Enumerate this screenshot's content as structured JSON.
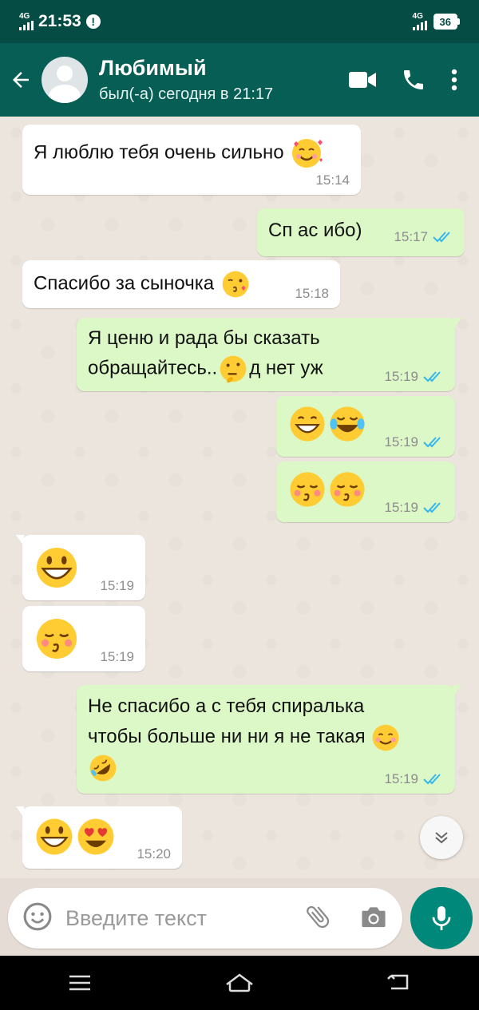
{
  "status_bar": {
    "time": "21:53",
    "network_left": "4G",
    "network_right": "4G",
    "battery": "36"
  },
  "header": {
    "contact_name": "Любимый",
    "last_seen": "был(-а) сегодня в 21:17"
  },
  "colors": {
    "header": "#075e54",
    "outgoing_bubble": "#dcf8c6",
    "incoming_bubble": "#ffffff",
    "read_ticks": "#34b7f1",
    "mic_button": "#00897b"
  },
  "messages": [
    {
      "dir": "in",
      "text": "Я люблю тебя очень сильно",
      "emoji": [
        "smiling-face-with-hearts"
      ],
      "time": "15:14"
    },
    {
      "dir": "out",
      "text": "Сп ас ибо)",
      "time": "15:17",
      "status": "read"
    },
    {
      "dir": "in",
      "text": "Спасибо за сыночка",
      "emoji": [
        "face-blowing-kiss"
      ],
      "time": "15:18"
    },
    {
      "dir": "out",
      "text": "Я ценю и рада бы сказать",
      "text2": "обращайтесь..",
      "text3": "д нет уж",
      "emoji": [
        "thinking-face"
      ],
      "time": "15:19",
      "status": "read"
    },
    {
      "dir": "out",
      "text": "",
      "emoji": [
        "beaming-face",
        "tears-of-joy-face"
      ],
      "time": "15:19",
      "status": "read"
    },
    {
      "dir": "out",
      "text": "",
      "emoji": [
        "kissing-face-closed-eyes",
        "kissing-face-closed-eyes"
      ],
      "time": "15:19",
      "status": "read"
    },
    {
      "dir": "in",
      "text": "",
      "emoji": [
        "grinning-face"
      ],
      "time": "15:19"
    },
    {
      "dir": "in",
      "text": "",
      "emoji": [
        "kissing-face-closed-eyes"
      ],
      "time": "15:19"
    },
    {
      "dir": "out",
      "text": "Не спасибо а с тебя спиралька",
      "text2": "чтобы больше ни ни я не такая",
      "emoji": [
        "smiling-face",
        "rofl-face"
      ],
      "time": "15:19",
      "status": "read"
    },
    {
      "dir": "in",
      "text": "",
      "emoji": [
        "grinning-face",
        "heart-eyes-face"
      ],
      "time": "15:20"
    }
  ],
  "input": {
    "placeholder": "Введите текст"
  },
  "icons": {
    "back": "arrow-left-icon",
    "video": "video-call-icon",
    "call": "phone-icon",
    "menu": "more-vert-icon",
    "emoji": "emoji-icon",
    "attach": "paperclip-icon",
    "camera": "camera-icon",
    "mic": "mic-icon",
    "scroll": "double-chevron-down-icon"
  }
}
